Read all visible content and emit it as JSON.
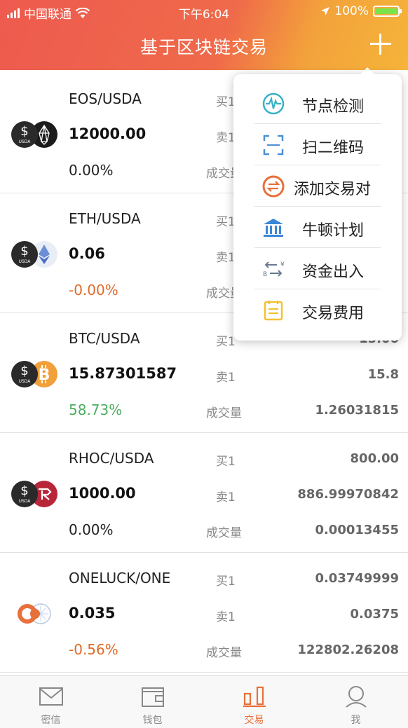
{
  "status": {
    "carrier": "中国联通",
    "time": "下午6:04",
    "battery": "100%"
  },
  "header": {
    "title": "基于区块链交易"
  },
  "labels": {
    "buy": "买1",
    "sell": "卖1",
    "volume": "成交量"
  },
  "rows": [
    {
      "pair": "EOS/USDA",
      "price": "12000.00",
      "change": "0.00%",
      "change_color": "#222222",
      "buy": "",
      "sell": "",
      "volume": ""
    },
    {
      "pair": "ETH/USDA",
      "price": "0.06",
      "change": "-0.00%",
      "change_color": "#e06b2a",
      "buy": "",
      "sell": "",
      "volume": ""
    },
    {
      "pair": "BTC/USDA",
      "price": "15.87301587",
      "change": "58.73%",
      "change_color": "#4cae60",
      "buy": "15.00",
      "sell": "15.8",
      "volume": "1.26031815"
    },
    {
      "pair": "RHOC/USDA",
      "price": "1000.00",
      "change": "0.00%",
      "change_color": "#222222",
      "buy": "800.00",
      "sell": "886.99970842",
      "volume": "0.00013455"
    },
    {
      "pair": "ONELUCK/ONE",
      "price": "0.035",
      "change": "-0.56%",
      "change_color": "#e06b2a",
      "buy": "0.03749999",
      "sell": "0.0375",
      "volume": "122802.26208"
    }
  ],
  "coin_icons": [
    "usda-eos-icon",
    "usda-eth-icon",
    "usda-btc-icon",
    "usda-rhoc-icon",
    "oneluck-one-icon"
  ],
  "coin_symbol": {
    "dollar": "$",
    "usda": "USDA"
  },
  "menu": [
    {
      "label": "节点检测",
      "icon": "pulse-icon"
    },
    {
      "label": "扫二维码",
      "icon": "scan-qr-icon"
    },
    {
      "label": "添加交易对",
      "icon": "add-pair-icon"
    },
    {
      "label": "牛顿计划",
      "icon": "bank-icon"
    },
    {
      "label": "资金出入",
      "icon": "transfer-icon"
    },
    {
      "label": "交易费用",
      "icon": "fee-icon"
    }
  ],
  "tabs": [
    {
      "label": "密信",
      "icon": "mail-icon",
      "active": false
    },
    {
      "label": "钱包",
      "icon": "wallet-icon",
      "active": false
    },
    {
      "label": "交易",
      "icon": "chart-icon",
      "active": true
    },
    {
      "label": "我",
      "icon": "profile-icon",
      "active": false
    }
  ],
  "colors": {
    "accent": "#e8703a",
    "header_start": "#ee5a4f",
    "header_end": "#f5b43a",
    "up": "#4cae60",
    "down": "#e06b2a"
  }
}
